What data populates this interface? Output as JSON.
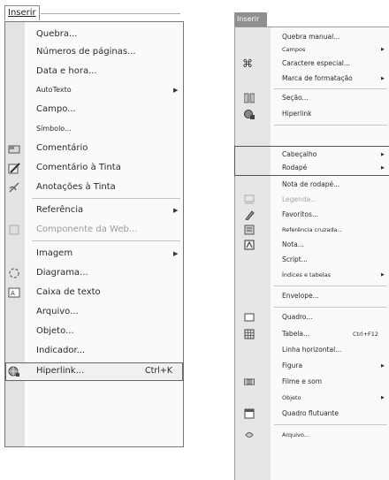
{
  "left_menu": {
    "tab_label": "Inserir",
    "items": [
      {
        "label": "Quebra..."
      },
      {
        "label": "Números de páginas..."
      },
      {
        "label": "Data e hora..."
      },
      {
        "label": "AutoTexto"
      },
      {
        "label": "Campo..."
      },
      {
        "label": "Símbolo..."
      },
      {
        "label": "Comentário"
      },
      {
        "label": "Comentário à Tinta"
      },
      {
        "label": "Anotações à Tinta"
      },
      {
        "label": "Referência"
      },
      {
        "label": "Componente da Web..."
      },
      {
        "label": "Imagem"
      },
      {
        "label": "Diagrama..."
      },
      {
        "label": "Caixa de texto"
      },
      {
        "label": "Arquivo..."
      },
      {
        "label": "Objeto..."
      },
      {
        "label": "Indicador..."
      },
      {
        "label": "Hiperlink...",
        "shortcut": "Ctrl+K"
      }
    ]
  },
  "right_menu": {
    "tab_label": "Inserir",
    "items": [
      {
        "label": "Quebra manual..."
      },
      {
        "label": "Campos"
      },
      {
        "label": "Caractere especial..."
      },
      {
        "label": "Marca de formatação"
      },
      {
        "label": "Seção..."
      },
      {
        "label": "Hiperlink"
      },
      {
        "label": "Cabeçalho"
      },
      {
        "label": "Rodapé"
      },
      {
        "label": "Nota de rodapé..."
      },
      {
        "label": "Legenda..."
      },
      {
        "label": "Favoritos..."
      },
      {
        "label": "Referência cruzada..."
      },
      {
        "label": "Nota..."
      },
      {
        "label": "Script..."
      },
      {
        "label": "Índices e tabelas"
      },
      {
        "label": "Envelope..."
      },
      {
        "label": "Quadro..."
      },
      {
        "label": "Tabela...",
        "shortcut": "Ctrl+F12"
      },
      {
        "label": "Linha horizontal..."
      },
      {
        "label": "Figura"
      },
      {
        "label": "Filme e som"
      },
      {
        "label": "Objeto"
      },
      {
        "label": "Quadro flutuante"
      },
      {
        "label": "Arquivo..."
      }
    ]
  },
  "icons": {
    "symbol": "command-key-icon",
    "highlight_border": "#555555"
  }
}
